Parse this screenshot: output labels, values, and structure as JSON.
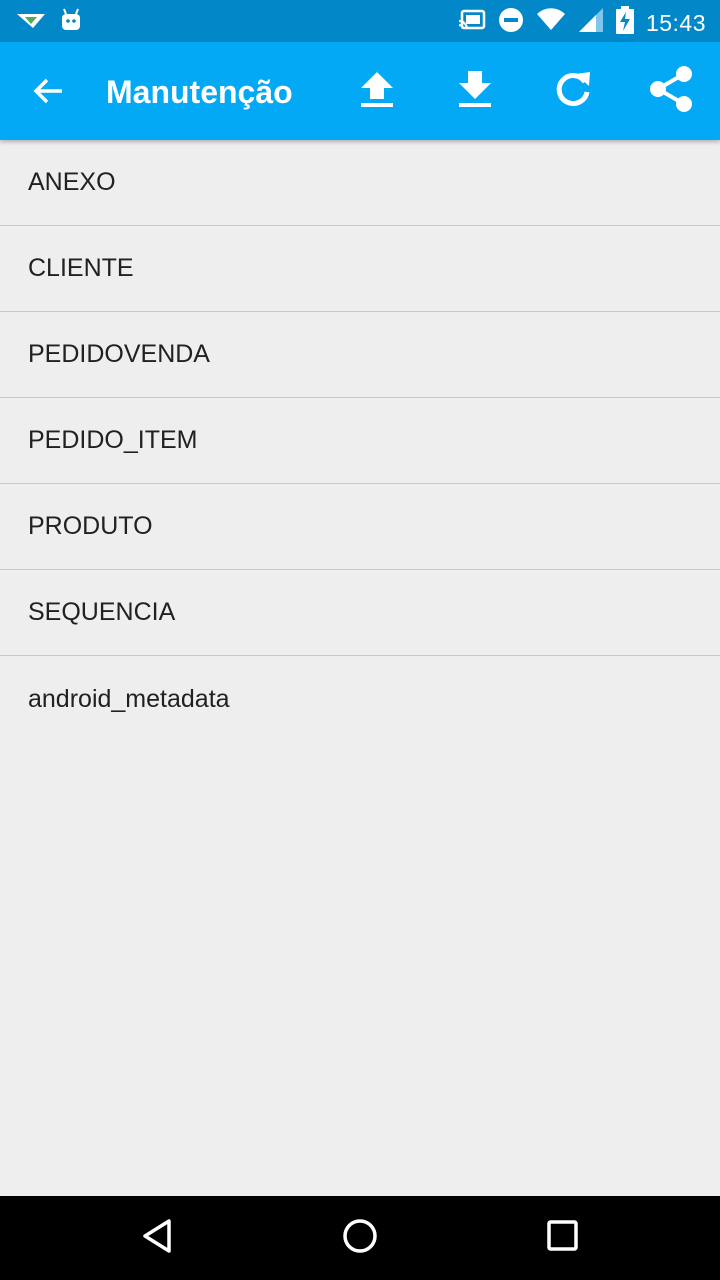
{
  "status_bar": {
    "time": "15:43",
    "icons": [
      "notification-arrow-icon",
      "android-icon",
      "cast-icon",
      "do-not-disturb-icon",
      "wifi-icon",
      "signal-icon",
      "battery-charging-icon"
    ]
  },
  "app_bar": {
    "title": "Manutenção",
    "background": "#03a9f4",
    "actions": [
      "upload-icon",
      "download-icon",
      "refresh-icon",
      "share-icon"
    ]
  },
  "tables": [
    "ANEXO",
    "CLIENTE",
    "PEDIDOVENDA",
    "PEDIDO_ITEM",
    "PRODUTO",
    "SEQUENCIA",
    "android_metadata"
  ],
  "nav_bar": {
    "buttons": [
      "back-icon",
      "home-icon",
      "recents-icon"
    ]
  }
}
